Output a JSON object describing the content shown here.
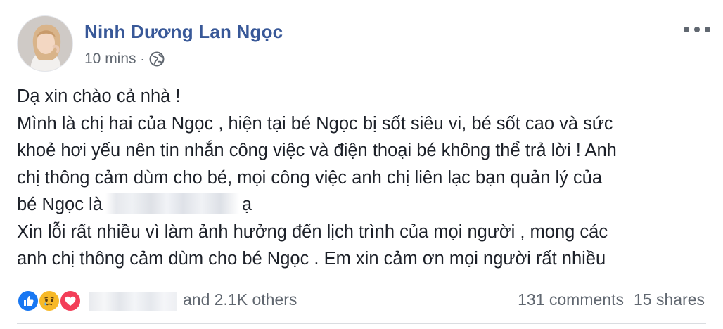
{
  "post": {
    "author": "Ninh Dương Lan Ngọc",
    "timestamp": "10 mins",
    "separator": "·",
    "privacy_icon": "globe-icon",
    "more_icon": "more-horizontal-icon",
    "body": {
      "line1": "Dạ xin chào cả nhà !",
      "line2": "Mình là chị hai của Ngọc , hiện tại bé Ngọc bị sốt siêu vi, bé sốt cao và sức",
      "line3": "khoẻ hơi yếu nên tin nhắn công việc và điện thoại bé không thể trả lời ! Anh",
      "line4": "chị thông cảm dùm cho bé, mọi công việc anh chị liên lạc bạn quản lý của",
      "line5_before": "bé Ngọc là",
      "line5_after": "ạ",
      "line6": "Xin lỗi rất nhiều vì làm ảnh hưởng đến lịch trình của mọi người , mong các",
      "line7": "anh chị thông cảm dùm cho bé Ngọc . Em xin cảm ơn mọi người rất nhiều"
    }
  },
  "reactions": {
    "icons": [
      "like-icon",
      "sad-icon",
      "love-icon"
    ],
    "others_text": "and 2.1K others",
    "comments": "131 comments",
    "shares": "15 shares"
  },
  "colors": {
    "author_name": "#385898",
    "secondary_text": "#606770",
    "like": "#1877f2",
    "sad": "#f7b928",
    "love": "#f33e58"
  }
}
